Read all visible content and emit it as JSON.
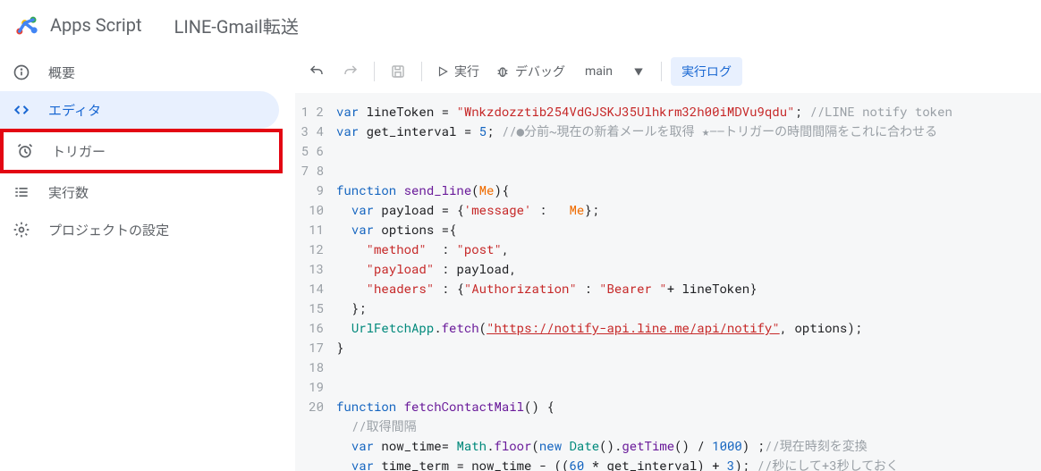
{
  "header": {
    "brand": "Apps Script",
    "project_title": "LINE-Gmail転送"
  },
  "sidebar": {
    "items": [
      {
        "icon": "info",
        "label": "概要"
      },
      {
        "icon": "code",
        "label": "エディタ",
        "active": true
      },
      {
        "icon": "clock",
        "label": "トリガー",
        "highlighted": true
      },
      {
        "icon": "list",
        "label": "実行数"
      },
      {
        "icon": "gear",
        "label": "プロジェクトの設定"
      }
    ]
  },
  "toolbar": {
    "undo_label": "元に戻す",
    "redo_label": "やり直し",
    "save_label": "保存",
    "run_label": "実行",
    "debug_label": "デバッグ",
    "function_selected": "main",
    "log_label": "実行ログ"
  },
  "code": {
    "token": "Wnkzdozztib254VdGJSKJ35Ulhkrm32h00iMDVu9qdu",
    "token_comment": "//LINE notify token",
    "interval_value": "5",
    "interval_comment": "//●分前~現在の新着メールを取得 ★――トリガーの時間間隔をこれに合わせる",
    "fn_send": "send_line",
    "param_me": "Me",
    "key_message": "message",
    "key_method": "method",
    "val_post": "post",
    "key_payload": "payload",
    "key_headers": "headers",
    "key_auth": "Authorization",
    "val_bearer": "Bearer ",
    "url": "https://notify-api.line.me/api/notify",
    "fn_fetch": "fetchContactMail",
    "cmt_interval": "//取得間隔",
    "cmt_nowtime": "//現在時刻を変換",
    "cmt_timeterm": "//秒にして+3秒しておく",
    "div1000": "1000",
    "mult60": "60",
    "plus3": "3"
  },
  "lines": 20
}
